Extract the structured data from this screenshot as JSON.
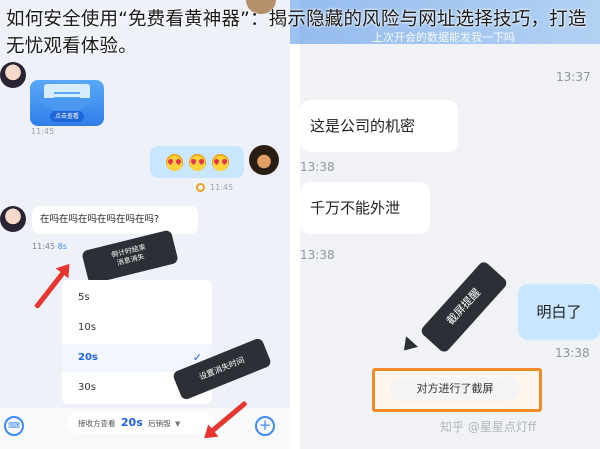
{
  "headline": "如何安全使用“免费看黄神器”：揭示隐藏的风险与网址选择技巧，打造无忧观看体验。",
  "left_panel": {
    "mail_card": {
      "cta_label": "点击查看",
      "timestamp": "11:45"
    },
    "emoji_message": {
      "emojis": [
        "heart-eyes",
        "heart-eyes",
        "heart-eyes"
      ],
      "timestamp": "11:45"
    },
    "question_message": {
      "text": "在吗在吗在吗在吗在吗在吗?",
      "timestamp": "11:45",
      "countdown": "8s"
    },
    "callout_countdown": "倒计时结束\n消息消失",
    "disappear_menu": {
      "options": [
        "5s",
        "10s",
        "20s",
        "30s"
      ],
      "selected": "20s"
    },
    "callout_set_time": "设置消失时间",
    "composer": {
      "prefix": "接收方查看",
      "value": "20s",
      "suffix": "后销毁",
      "caret": "▼"
    },
    "accent_color": "#1e62ea",
    "arrow_color": "#e8352f"
  },
  "right_panel": {
    "header_text": "上次开会的数据能发我一下吗",
    "header_timestamp": "13:37",
    "messages": [
      {
        "text": "这是公司的机密",
        "timestamp": "13:38",
        "direction": "in"
      },
      {
        "text": "千万不能外泄",
        "timestamp": "13:38",
        "direction": "in"
      },
      {
        "text": "明白了",
        "timestamp": "13:38",
        "direction": "out"
      }
    ],
    "screenshot_callout": "截屏提醒",
    "screenshot_notice": "对方进行了截屏",
    "watermark": "知乎 @星星点灯ff",
    "highlight_color": "#f08a24"
  }
}
